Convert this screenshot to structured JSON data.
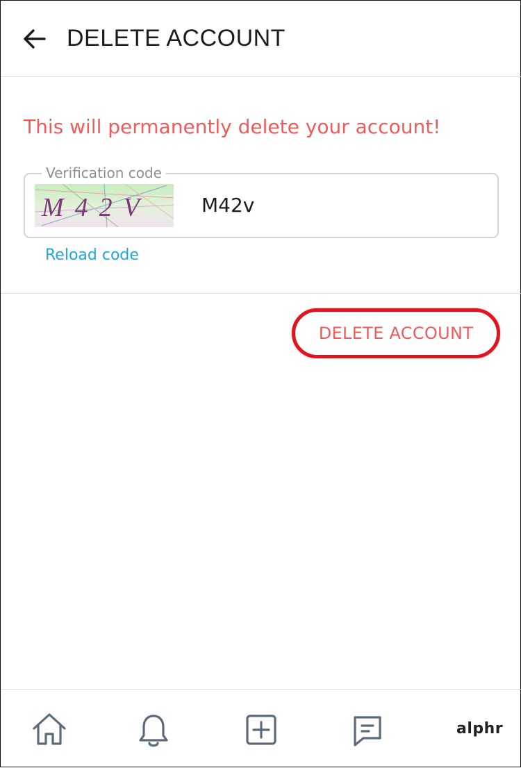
{
  "header": {
    "title": "DELETE ACCOUNT",
    "back_icon": "arrow-left-icon"
  },
  "main": {
    "warning": "This will permanently delete your account!",
    "verification": {
      "label": "Verification code",
      "captcha_text": "M42V",
      "value": "M42v"
    },
    "reload_label": "Reload code",
    "delete_label": "DELETE ACCOUNT",
    "colors": {
      "warning": "#ef5b5b",
      "link": "#1fa7e0",
      "highlight": "#e0141c"
    }
  },
  "nav": {
    "items": [
      {
        "icon": "home-icon"
      },
      {
        "icon": "bell-icon"
      },
      {
        "icon": "plus-square-icon"
      },
      {
        "icon": "chat-icon"
      }
    ],
    "brand": "alphr"
  }
}
